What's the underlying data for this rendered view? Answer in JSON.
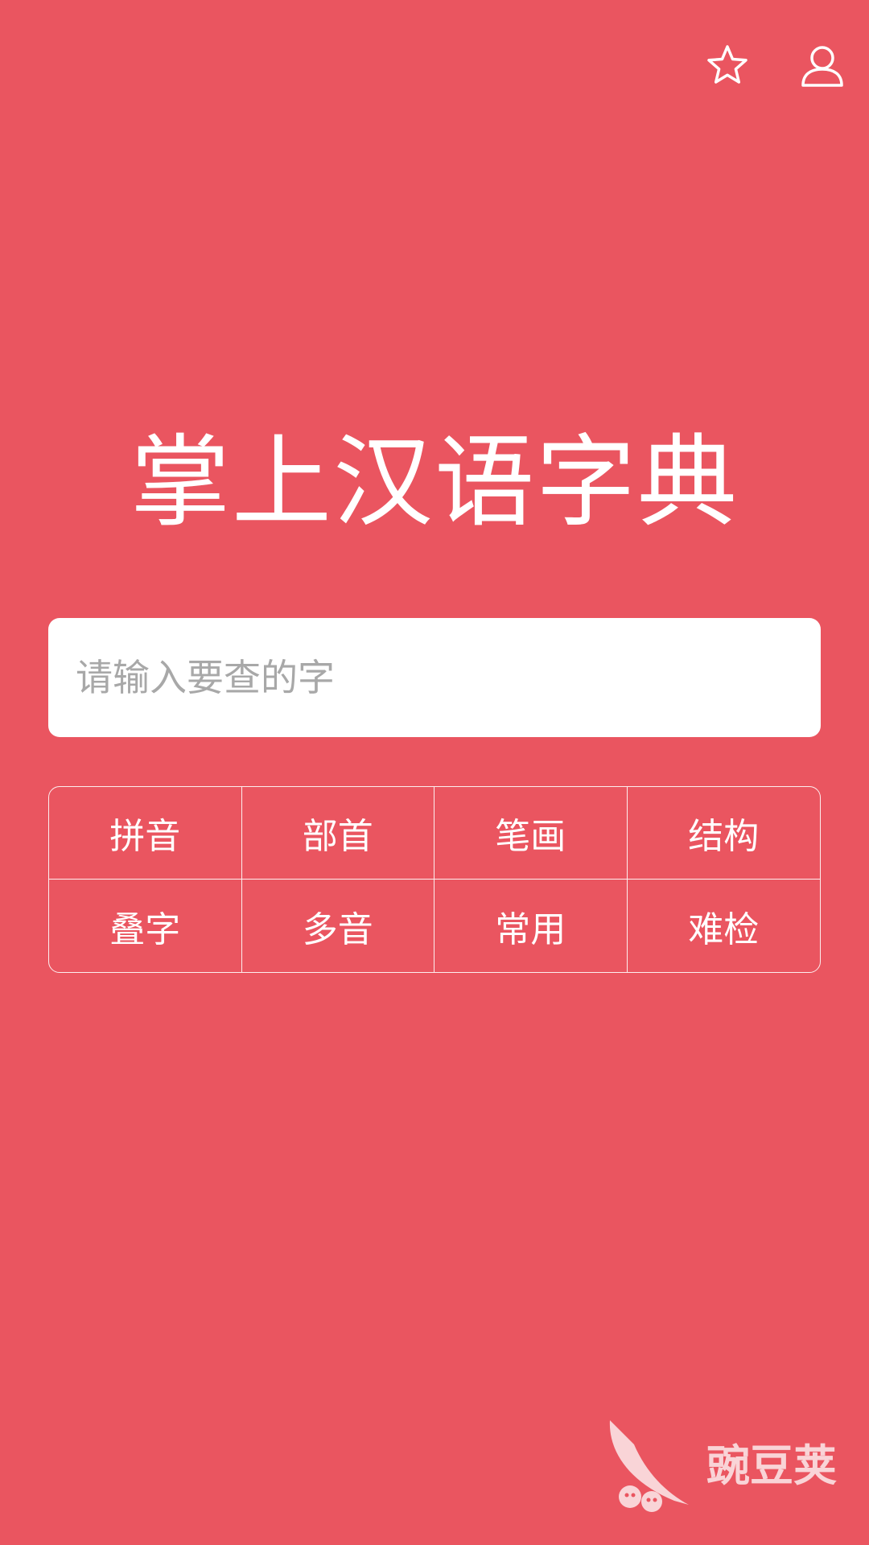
{
  "header": {
    "icons": {
      "favorite": "star-outline-icon",
      "profile": "user-outline-icon"
    }
  },
  "main": {
    "title": "掌上汉语字典",
    "search": {
      "placeholder": "请输入要查的字",
      "value": ""
    },
    "categories": [
      {
        "label": "拼音"
      },
      {
        "label": "部首"
      },
      {
        "label": "笔画"
      },
      {
        "label": "结构"
      },
      {
        "label": "叠字"
      },
      {
        "label": "多音"
      },
      {
        "label": "常用"
      },
      {
        "label": "难检"
      }
    ]
  },
  "watermark": {
    "text": "豌豆荚"
  },
  "colors": {
    "background": "#EA5560",
    "text": "#FFFFFF",
    "placeholder": "#A8A8A8"
  }
}
